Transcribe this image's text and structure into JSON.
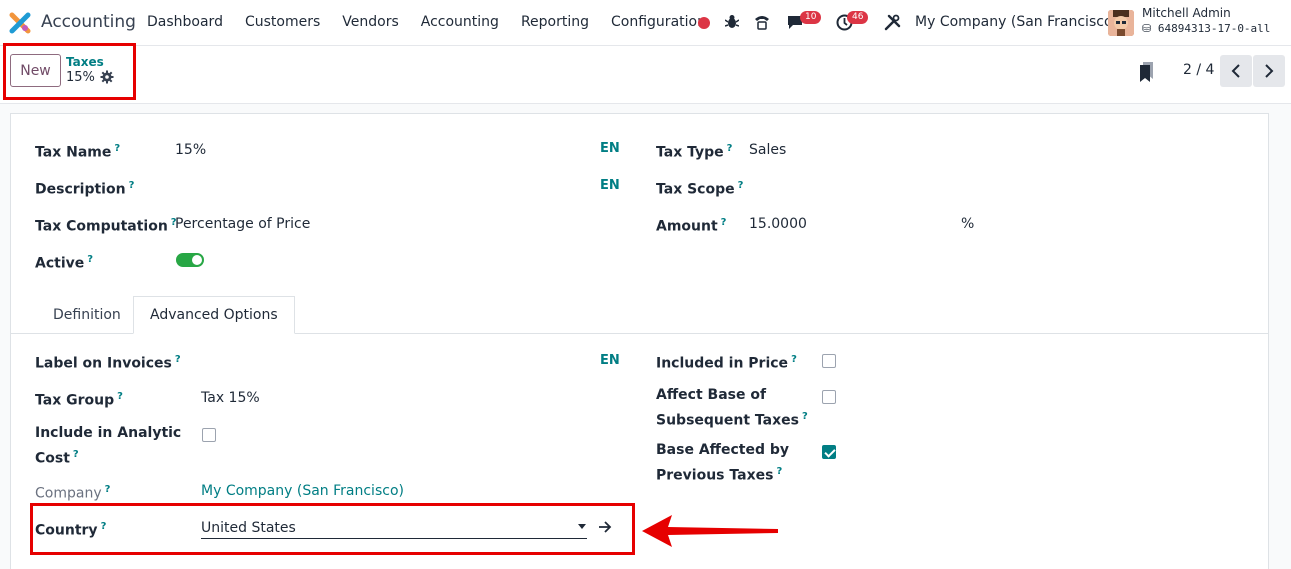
{
  "navbar": {
    "app_name": "Accounting",
    "menu": [
      "Dashboard",
      "Customers",
      "Vendors",
      "Accounting",
      "Reporting",
      "Configuration"
    ],
    "chat_count": "10",
    "activity_count": "46",
    "company": "My Company (San Francisco)",
    "user_name": "Mitchell Admin",
    "db_name": "64894313-17-0-all"
  },
  "control": {
    "new_label": "New",
    "breadcrumb_parent": "Taxes",
    "breadcrumb_current": "15%",
    "pager": "2 / 4"
  },
  "form": {
    "tax_name_label": "Tax Name",
    "tax_name": "15%",
    "description_label": "Description",
    "tax_computation_label": "Tax Computation",
    "tax_computation": "Percentage of Price",
    "active_label": "Active",
    "active": true,
    "tax_type_label": "Tax Type",
    "tax_type": "Sales",
    "tax_scope_label": "Tax Scope",
    "amount_label": "Amount",
    "amount": "15.0000",
    "amount_unit": "%",
    "lang": "EN",
    "help_mark": "?"
  },
  "tabs": {
    "definition": "Definition",
    "advanced": "Advanced Options"
  },
  "advanced": {
    "label_on_invoices_label": "Label on Invoices",
    "tax_group_label": "Tax Group",
    "tax_group": "Tax 15%",
    "include_analytic_label_1": "Include in Analytic",
    "include_analytic_label_2": "Cost",
    "company_label": "Company",
    "company": "My Company (San Francisco)",
    "country_label": "Country",
    "country": "United States",
    "included_in_price_label": "Included in Price",
    "affect_base_label_1": "Affect Base of",
    "affect_base_label_2": "Subsequent Taxes",
    "base_affected_label_1": "Base Affected by",
    "base_affected_label_2": "Previous Taxes",
    "included_in_price": false,
    "affect_base": false,
    "base_affected": true,
    "include_analytic": false
  },
  "colors": {
    "accent": "#017e84",
    "brand": "#714b67",
    "highlight": "#e60000"
  }
}
